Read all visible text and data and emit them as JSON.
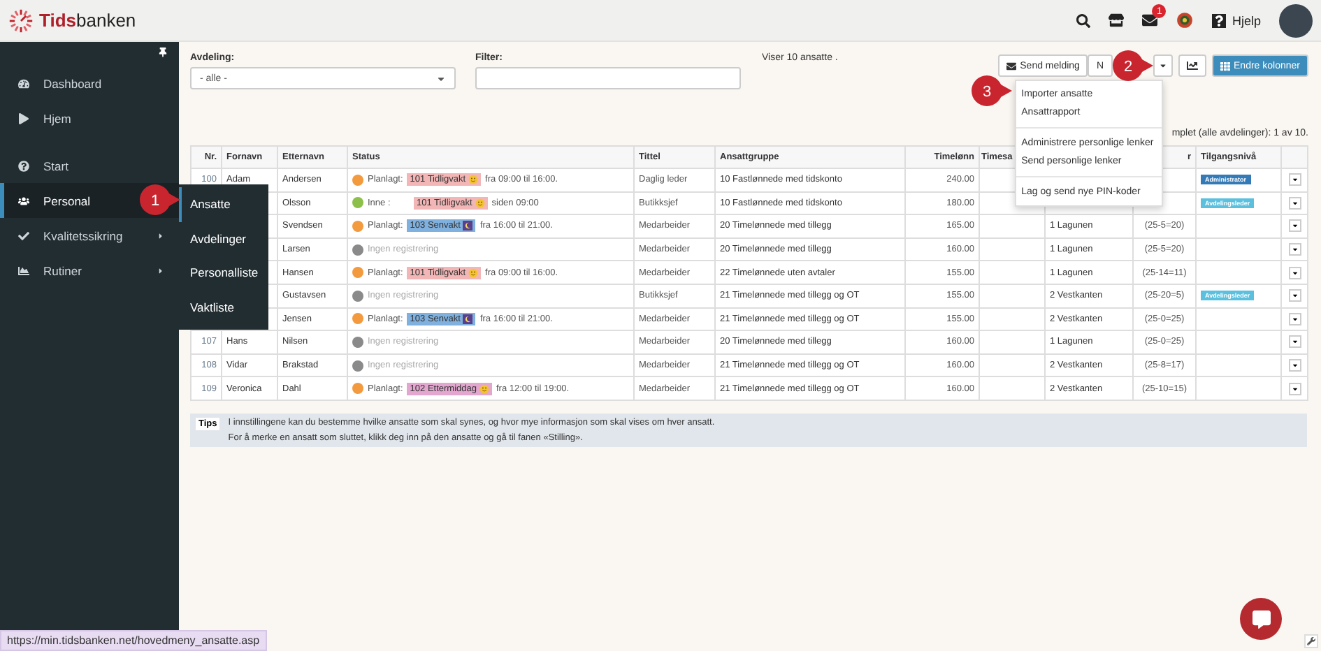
{
  "topbar": {
    "logo_bold": "Tids",
    "logo_rest": "banken",
    "mail_badge": "1",
    "help": "Hjelp"
  },
  "sidebar": {
    "items": [
      {
        "label": "Dashboard",
        "selected": false,
        "has_submenu": false
      },
      {
        "label": "Hjem",
        "selected": false,
        "has_submenu": false
      },
      {
        "label": "Start",
        "selected": false,
        "has_submenu": false
      },
      {
        "label": "Personal",
        "selected": true,
        "has_submenu": false
      },
      {
        "label": "Kvalitetssikring",
        "selected": false,
        "has_submenu": true
      },
      {
        "label": "Rutiner",
        "selected": false,
        "has_submenu": true
      }
    ]
  },
  "submenu": [
    {
      "label": "Ansatte",
      "selected": true
    },
    {
      "label": "Avdelinger",
      "selected": false
    },
    {
      "label": "Personalliste",
      "selected": false
    },
    {
      "label": "Vaktliste",
      "selected": false
    }
  ],
  "callouts": [
    "1",
    "2",
    "3"
  ],
  "filters": {
    "department_label": "Avdeling:",
    "department_value": "- alle -",
    "filter_label": "Filter:",
    "count_text": "Viser 10 ansatte ."
  },
  "toolbar": {
    "send_button": "Send melding",
    "second_button": "N",
    "columns_button": "Endre kolonner"
  },
  "dropdown_menu": [
    [
      "Importer ansatte",
      "Ansattrapport"
    ],
    [
      "Administrere personlige lenker",
      "Send personlige lenker"
    ],
    [
      "Lag og send nye PIN-koder"
    ]
  ],
  "summary_text": "mplet (alle avdelinger): 1 av 10.",
  "table": {
    "columns": [
      {
        "label": "Nr."
      },
      {
        "label": "Fornavn"
      },
      {
        "label": "Etternavn"
      },
      {
        "label": "Status"
      },
      {
        "label": "Tittel"
      },
      {
        "label": "Ansattgruppe"
      },
      {
        "label": "Timelønn"
      },
      {
        "label": "Timesa"
      },
      {},
      {
        "label": "r"
      },
      {
        "label": "Tilgangsnivå"
      },
      {}
    ],
    "rows": [
      {
        "nr": "100",
        "first_name": "Adam",
        "last_name": "Andersen",
        "status": {
          "kind": "planned",
          "color": "#f39a3e",
          "label": "Planlagt:",
          "shift": {
            "text": "101 Tidligvakt",
            "color": "#f3b6b6",
            "kind": "day"
          },
          "time": "fra 09:00 til 16:00."
        },
        "title": "Daglig leder",
        "group": "10 Fastlønnede med tidskonto",
        "wage": "240.00",
        "access": {
          "text": "Administrator",
          "color": "#337ab7"
        }
      },
      {
        "last_name": "Olsson",
        "status": {
          "kind": "in",
          "color": "#8dc04a",
          "label": "Inne :",
          "shift": {
            "text": "101 Tidligvakt",
            "color": "#f3b6b6",
            "kind": "day"
          },
          "time": "siden 09:00"
        },
        "title": "Butikksjef",
        "group": "10 Fastlønnede med tidskonto",
        "wage": "180.00",
        "access": {
          "text": "Avdelingsleder",
          "color": "#5bc0de"
        }
      },
      {
        "last_name": "Svendsen",
        "status": {
          "kind": "planned",
          "color": "#f39a3e",
          "label": "Planlagt:",
          "shift": {
            "text": "103 Senvakt",
            "color": "#7fb0de",
            "kind": "night"
          },
          "time": "fra 16:00 til 21:00."
        },
        "title": "Medarbeider",
        "group": "20 Timelønnede med tillegg",
        "wage": "165.00",
        "department": "1 Lagunen",
        "balance": "(25-5=20)"
      },
      {
        "last_name": "Larsen",
        "status": {
          "kind": "none",
          "color": "#8a8a8a",
          "label": "Ingen registrering"
        },
        "title": "Medarbeider",
        "group": "20 Timelønnede med tillegg",
        "wage": "160.00",
        "department": "1 Lagunen",
        "balance": "(25-5=20)"
      },
      {
        "last_name": "Hansen",
        "status": {
          "kind": "planned",
          "color": "#f39a3e",
          "label": "Planlagt:",
          "shift": {
            "text": "101 Tidligvakt",
            "color": "#f3b6b6",
            "kind": "day"
          },
          "time": "fra 09:00 til 16:00."
        },
        "title": "Medarbeider",
        "group": "22 Timelønnede uten avtaler",
        "wage": "155.00",
        "department": "1 Lagunen",
        "balance": "(25-14=11)"
      },
      {
        "last_name": "Gustavsen",
        "status": {
          "kind": "none",
          "color": "#8a8a8a",
          "label": "Ingen registrering"
        },
        "title": "Butikksjef",
        "group": "21 Timelønnede med tillegg og OT",
        "wage": "155.00",
        "department": "2 Vestkanten",
        "balance": "(25-20=5)",
        "access": {
          "text": "Avdelingsleder",
          "color": "#5bc0de"
        }
      },
      {
        "last_name": "Jensen",
        "status": {
          "kind": "planned",
          "color": "#f39a3e",
          "label": "Planlagt:",
          "shift": {
            "text": "103 Senvakt",
            "color": "#7fb0de",
            "kind": "night"
          },
          "time": "fra 16:00 til 21:00."
        },
        "title": "Medarbeider",
        "group": "21 Timelønnede med tillegg og OT",
        "wage": "155.00",
        "department": "2 Vestkanten",
        "balance": "(25-0=25)"
      },
      {
        "nr": "107",
        "first_name": "Hans",
        "last_name": "Nilsen",
        "status": {
          "kind": "none",
          "color": "#8a8a8a",
          "label": "Ingen registrering"
        },
        "title": "Medarbeider",
        "group": "20 Timelønnede med tillegg",
        "wage": "160.00",
        "department": "1 Lagunen",
        "balance": "(25-0=25)"
      },
      {
        "nr": "108",
        "first_name": "Vidar",
        "last_name": "Brakstad",
        "status": {
          "kind": "none",
          "color": "#8a8a8a",
          "label": "Ingen registrering"
        },
        "title": "Medarbeider",
        "group": "21 Timelønnede med tillegg og OT",
        "wage": "160.00",
        "department": "2 Vestkanten",
        "balance": "(25-8=17)"
      },
      {
        "nr": "109",
        "first_name": "Veronica",
        "last_name": "Dahl",
        "status": {
          "kind": "planned",
          "color": "#f39a3e",
          "label": "Planlagt:",
          "shift": {
            "text": "102 Ettermiddag",
            "color": "#e2a6cf",
            "kind": "day"
          },
          "time": "fra 12:00 til 19:00."
        },
        "title": "Medarbeider",
        "group": "21 Timelønnede med tillegg og OT",
        "wage": "160.00",
        "department": "2 Vestkanten",
        "balance": "(25-10=15)"
      }
    ]
  },
  "tips": {
    "label": "Tips",
    "lines": [
      "I innstillingene kan du bestemme hvilke ansatte som skal synes, og hvor mye informasjon som skal vises om hver ansatt.",
      "For å merke en ansatt som sluttet, klikk deg inn på den ansatte og gå til fanen «Stilling»."
    ]
  },
  "status_url": "https://min.tidsbanken.net/hovedmeny_ansatte.asp"
}
